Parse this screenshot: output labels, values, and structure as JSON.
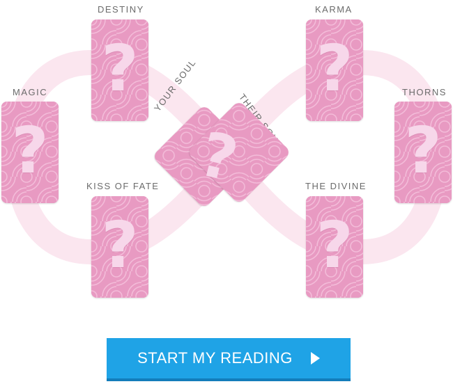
{
  "spread": {
    "labels": {
      "destiny": "DESTINY",
      "karma": "KARMA",
      "magic": "MAGIC",
      "thorns": "THORNS",
      "kiss_of_fate": "KISS OF FATE",
      "the_divine": "THE DIVINE",
      "your_soul": "YOUR SOUL",
      "their_soul": "THEIR SOUL"
    },
    "card_symbol": "?",
    "colors": {
      "card": "#e89ac2",
      "card_pattern": "#f3bcd9",
      "infinity": "#fbeaf2",
      "button": "#1fa3e6"
    }
  },
  "cta": {
    "label": "START MY READING",
    "icon": "play-arrow-icon"
  }
}
